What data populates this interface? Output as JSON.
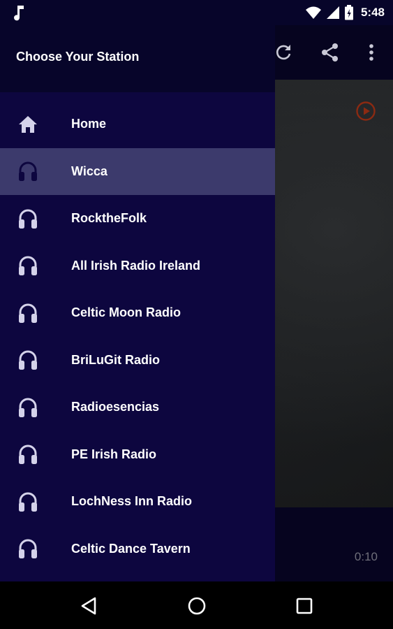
{
  "status_bar": {
    "time": "5:48",
    "icons": [
      "music-note-icon",
      "wifi-icon",
      "cell-signal-icon",
      "battery-icon"
    ]
  },
  "drawer": {
    "title": "Choose Your Station",
    "active_index": 1,
    "items": [
      {
        "label": "Home",
        "icon": "home-icon"
      },
      {
        "label": "Wicca",
        "icon": "headphones-icon"
      },
      {
        "label": "RocktheFolk",
        "icon": "headphones-icon"
      },
      {
        "label": "All Irish Radio Ireland",
        "icon": "headphones-icon"
      },
      {
        "label": "Celtic Moon Radio",
        "icon": "headphones-icon"
      },
      {
        "label": "BriLuGit Radio",
        "icon": "headphones-icon"
      },
      {
        "label": "Radioesencias",
        "icon": "headphones-icon"
      },
      {
        "label": "PE Irish Radio",
        "icon": "headphones-icon"
      },
      {
        "label": "LochNess Inn Radio",
        "icon": "headphones-icon"
      },
      {
        "label": "Celtic Dance Tavern",
        "icon": "headphones-icon"
      }
    ]
  },
  "toolbar": {
    "icons": [
      "refresh-icon",
      "share-icon",
      "more-vert-icon"
    ]
  },
  "player": {
    "elapsed": "0:10",
    "play_icon": "play-circle-icon"
  },
  "nav_bar": {
    "icons": [
      "back-icon",
      "home-circle-icon",
      "recents-icon"
    ]
  },
  "colors": {
    "drawer_bg": "#0d063f",
    "drawer_header_bg": "#07052a",
    "active_item_bg": "#3c3a6c",
    "icon_tint": "#d4d2ea",
    "play_accent": "#8b2a12"
  }
}
